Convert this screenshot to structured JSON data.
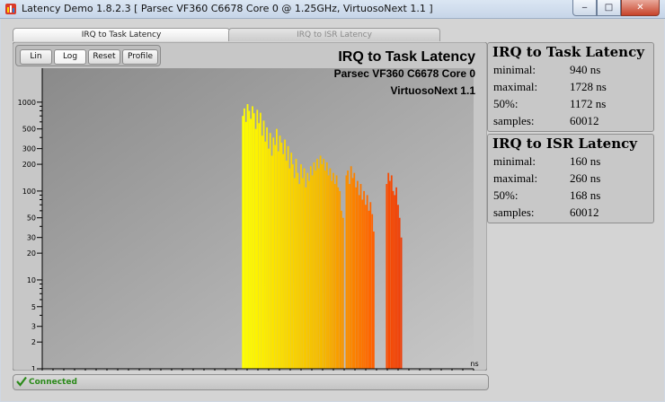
{
  "window": {
    "title": "Latency Demo 1.8.2.3  [ Parsec VF360 C6678 Core 0 @ 1.25GHz, VirtuosoNext 1.1 ]",
    "minimize_icon": "minimize-icon",
    "maximize_icon": "maximize-icon",
    "close_icon": "close-icon"
  },
  "tabs": [
    {
      "label": "IRQ to Task Latency",
      "active": true
    },
    {
      "label": "IRQ to ISR Latency",
      "active": false
    }
  ],
  "toolbar": {
    "lin": "Lin",
    "log": "Log",
    "reset": "Reset",
    "profile": "Profile",
    "selected": "Log"
  },
  "chart_titles": {
    "line1": "IRQ to Task Latency",
    "line2": "Parsec VF360 C6678 Core 0",
    "line3": "VirtuosoNext 1.1"
  },
  "chart_data": {
    "type": "bar",
    "y_scale": "log",
    "x_unit_label": "ns",
    "xlim": [
      0,
      2000
    ],
    "ylim": [
      1,
      1200
    ],
    "x_ticks": [
      0,
      250,
      500,
      750,
      1000,
      1250,
      1500,
      1750,
      2000
    ],
    "y_tick_labels": [
      {
        "v": 1,
        "label": "1"
      },
      {
        "v": 2,
        "label": "2"
      },
      {
        "v": 3,
        "label": "3"
      },
      {
        "v": 5,
        "label": "5"
      },
      {
        "v": 10,
        "label": "10"
      },
      {
        "v": 20,
        "label": "20"
      },
      {
        "v": 30,
        "label": "30"
      },
      {
        "v": 50,
        "label": "50"
      },
      {
        "v": 100,
        "label": "100"
      },
      {
        "v": 200,
        "label": "200"
      },
      {
        "v": 300,
        "label": "300"
      },
      {
        "v": 500,
        "label": "500"
      },
      {
        "v": 1000,
        "label": "1000"
      }
    ],
    "minor_ticks": [
      4,
      6,
      7,
      8,
      9,
      40,
      60,
      70,
      80,
      90,
      400,
      600,
      700,
      800,
      900
    ],
    "bins": [
      {
        "x": 930,
        "y": 700
      },
      {
        "x": 937,
        "y": 850
      },
      {
        "x": 945,
        "y": 600
      },
      {
        "x": 952,
        "y": 950
      },
      {
        "x": 960,
        "y": 800
      },
      {
        "x": 967,
        "y": 650
      },
      {
        "x": 975,
        "y": 900
      },
      {
        "x": 982,
        "y": 750
      },
      {
        "x": 990,
        "y": 500
      },
      {
        "x": 997,
        "y": 820
      },
      {
        "x": 1005,
        "y": 580
      },
      {
        "x": 1012,
        "y": 760
      },
      {
        "x": 1020,
        "y": 420
      },
      {
        "x": 1027,
        "y": 620
      },
      {
        "x": 1035,
        "y": 360
      },
      {
        "x": 1042,
        "y": 520
      },
      {
        "x": 1050,
        "y": 300
      },
      {
        "x": 1057,
        "y": 450
      },
      {
        "x": 1065,
        "y": 250
      },
      {
        "x": 1072,
        "y": 400
      },
      {
        "x": 1080,
        "y": 330
      },
      {
        "x": 1087,
        "y": 500
      },
      {
        "x": 1095,
        "y": 280
      },
      {
        "x": 1102,
        "y": 420
      },
      {
        "x": 1110,
        "y": 350
      },
      {
        "x": 1117,
        "y": 260
      },
      {
        "x": 1125,
        "y": 380
      },
      {
        "x": 1132,
        "y": 220
      },
      {
        "x": 1140,
        "y": 320
      },
      {
        "x": 1147,
        "y": 180
      },
      {
        "x": 1155,
        "y": 270
      },
      {
        "x": 1162,
        "y": 200
      },
      {
        "x": 1170,
        "y": 140
      },
      {
        "x": 1177,
        "y": 230
      },
      {
        "x": 1185,
        "y": 160
      },
      {
        "x": 1192,
        "y": 120
      },
      {
        "x": 1200,
        "y": 200
      },
      {
        "x": 1207,
        "y": 140
      },
      {
        "x": 1215,
        "y": 180
      },
      {
        "x": 1222,
        "y": 110
      },
      {
        "x": 1230,
        "y": 160
      },
      {
        "x": 1237,
        "y": 130
      },
      {
        "x": 1245,
        "y": 190
      },
      {
        "x": 1252,
        "y": 150
      },
      {
        "x": 1260,
        "y": 210
      },
      {
        "x": 1267,
        "y": 170
      },
      {
        "x": 1275,
        "y": 230
      },
      {
        "x": 1282,
        "y": 180
      },
      {
        "x": 1290,
        "y": 250
      },
      {
        "x": 1297,
        "y": 200
      },
      {
        "x": 1305,
        "y": 230
      },
      {
        "x": 1312,
        "y": 170
      },
      {
        "x": 1320,
        "y": 210
      },
      {
        "x": 1327,
        "y": 150
      },
      {
        "x": 1335,
        "y": 180
      },
      {
        "x": 1342,
        "y": 130
      },
      {
        "x": 1350,
        "y": 160
      },
      {
        "x": 1357,
        "y": 120
      },
      {
        "x": 1365,
        "y": 150
      },
      {
        "x": 1372,
        "y": 110
      },
      {
        "x": 1380,
        "y": 100
      },
      {
        "x": 1387,
        "y": 60
      },
      {
        "x": 1395,
        "y": 50
      },
      {
        "x": 1410,
        "y": 150
      },
      {
        "x": 1417,
        "y": 170
      },
      {
        "x": 1425,
        "y": 120
      },
      {
        "x": 1432,
        "y": 190
      },
      {
        "x": 1440,
        "y": 140
      },
      {
        "x": 1447,
        "y": 160
      },
      {
        "x": 1455,
        "y": 110
      },
      {
        "x": 1462,
        "y": 130
      },
      {
        "x": 1470,
        "y": 90
      },
      {
        "x": 1477,
        "y": 120
      },
      {
        "x": 1485,
        "y": 80
      },
      {
        "x": 1492,
        "y": 100
      },
      {
        "x": 1500,
        "y": 70
      },
      {
        "x": 1507,
        "y": 90
      },
      {
        "x": 1515,
        "y": 60
      },
      {
        "x": 1522,
        "y": 75
      },
      {
        "x": 1530,
        "y": 55
      },
      {
        "x": 1537,
        "y": 35
      },
      {
        "x": 1597,
        "y": 120
      },
      {
        "x": 1605,
        "y": 160
      },
      {
        "x": 1612,
        "y": 130
      },
      {
        "x": 1620,
        "y": 150
      },
      {
        "x": 1627,
        "y": 100
      },
      {
        "x": 1635,
        "y": 90
      },
      {
        "x": 1642,
        "y": 110
      },
      {
        "x": 1650,
        "y": 70
      },
      {
        "x": 1657,
        "y": 50
      },
      {
        "x": 1665,
        "y": 30
      }
    ]
  },
  "stats": [
    {
      "title": "IRQ to Task Latency",
      "rows": [
        {
          "label": "minimal:",
          "value": "940 ns"
        },
        {
          "label": "maximal:",
          "value": "1728 ns"
        },
        {
          "label": "50%:",
          "value": "1172 ns"
        },
        {
          "label": "samples:",
          "value": "60012"
        }
      ]
    },
    {
      "title": "IRQ to ISR Latency",
      "rows": [
        {
          "label": "minimal:",
          "value": "160 ns"
        },
        {
          "label": "maximal:",
          "value": "260 ns"
        },
        {
          "label": "50%:",
          "value": "168 ns"
        },
        {
          "label": "samples:",
          "value": "60012"
        }
      ]
    }
  ],
  "status": {
    "text": "Connected",
    "icon": "check-icon",
    "color": "#2b8a1a"
  }
}
